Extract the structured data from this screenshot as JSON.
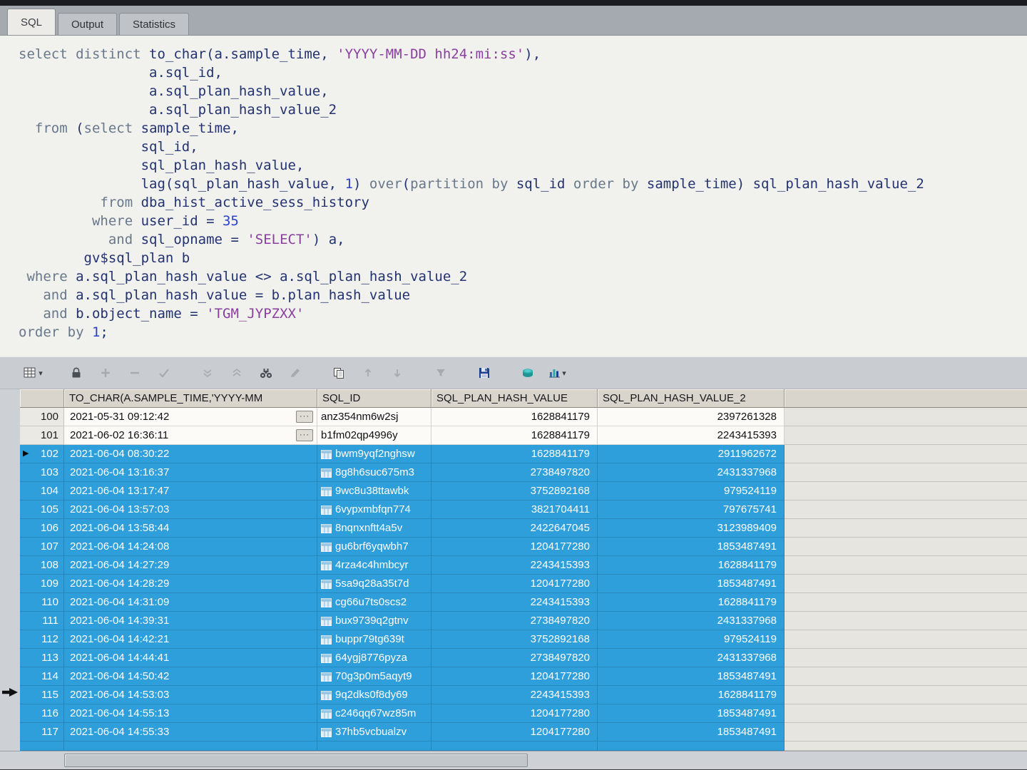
{
  "colors": {
    "selection": "#2E9FDB",
    "keyword": "#68788A",
    "identifier": "#233271",
    "string": "#8A3F9E",
    "number": "#2B3FD0"
  },
  "tabs": [
    {
      "label": "SQL",
      "active": true
    },
    {
      "label": "Output",
      "active": false
    },
    {
      "label": "Statistics",
      "active": false
    }
  ],
  "editor": {
    "lines": [
      [
        [
          "k",
          "select distinct "
        ],
        [
          "i",
          "to_char(a.sample_time, "
        ],
        [
          "s",
          "'YYYY-MM-DD hh24:mi:ss'"
        ],
        [
          "i",
          "),"
        ]
      ],
      [
        [
          "i",
          "                a.sql_id,"
        ]
      ],
      [
        [
          "i",
          "                a.sql_plan_hash_value,"
        ]
      ],
      [
        [
          "i",
          "                a.sql_plan_hash_value_2"
        ]
      ],
      [
        [
          "i",
          "  "
        ],
        [
          "k",
          "from "
        ],
        [
          "i",
          "("
        ],
        [
          "k",
          "select "
        ],
        [
          "i",
          "sample_time,"
        ]
      ],
      [
        [
          "i",
          "               sql_id,"
        ]
      ],
      [
        [
          "i",
          "               sql_plan_hash_value,"
        ]
      ],
      [
        [
          "i",
          "               lag(sql_plan_hash_value, "
        ],
        [
          "n",
          "1"
        ],
        [
          "i",
          ") "
        ],
        [
          "k",
          "over"
        ],
        [
          "i",
          "("
        ],
        [
          "k",
          "partition by "
        ],
        [
          "i",
          "sql_id "
        ],
        [
          "k",
          "order by "
        ],
        [
          "i",
          "sample_time) sql_plan_hash_value_2"
        ]
      ],
      [
        [
          "i",
          "          "
        ],
        [
          "k",
          "from "
        ],
        [
          "i",
          "dba_hist_active_sess_history"
        ]
      ],
      [
        [
          "i",
          "         "
        ],
        [
          "k",
          "where "
        ],
        [
          "i",
          "user_id = "
        ],
        [
          "n",
          "35"
        ]
      ],
      [
        [
          "i",
          "           "
        ],
        [
          "k",
          "and "
        ],
        [
          "i",
          "sql_opname = "
        ],
        [
          "s",
          "'SELECT'"
        ],
        [
          "i",
          ") a,"
        ]
      ],
      [
        [
          "i",
          "        gv$sql_plan b"
        ]
      ],
      [
        [
          "i",
          " "
        ],
        [
          "k",
          "where "
        ],
        [
          "i",
          "a.sql_plan_hash_value <> a.sql_plan_hash_value_2"
        ]
      ],
      [
        [
          "i",
          "   "
        ],
        [
          "k",
          "and "
        ],
        [
          "i",
          "a.sql_plan_hash_value = b.plan_hash_value"
        ]
      ],
      [
        [
          "i",
          "   "
        ],
        [
          "k",
          "and "
        ],
        [
          "i",
          "b.object_name = "
        ],
        [
          "s",
          "'TGM_JYPZXX'"
        ]
      ],
      [
        [
          "k",
          "order by "
        ],
        [
          "n",
          "1"
        ],
        [
          "i",
          ";"
        ]
      ]
    ]
  },
  "toolbar": {
    "icons": [
      {
        "name": "grid-options-icon",
        "dropdown": true
      },
      {
        "name": "lock-icon",
        "gapBefore": true
      },
      {
        "name": "insert-row-icon",
        "disabled": true
      },
      {
        "name": "delete-row-icon",
        "disabled": true
      },
      {
        "name": "post-changes-icon",
        "disabled": true
      },
      {
        "name": "revert-icon",
        "disabled": true,
        "gapBefore": true
      },
      {
        "name": "refresh-icon",
        "disabled": true
      },
      {
        "name": "find-icon"
      },
      {
        "name": "edit-icon",
        "disabled": true
      },
      {
        "name": "copy-icon",
        "gapBefore": true
      },
      {
        "name": "sort-asc-icon",
        "disabled": true
      },
      {
        "name": "sort-desc-icon",
        "disabled": true
      },
      {
        "name": "filter-icon",
        "disabled": true,
        "gapBefore": true
      },
      {
        "name": "save-icon",
        "gapBefore": true
      },
      {
        "name": "export-icon",
        "gapBefore": true
      },
      {
        "name": "chart-icon",
        "dropdown": true
      }
    ]
  },
  "grid": {
    "columns": [
      {
        "label": "TO_CHAR(A.SAMPLE_TIME,'YYYY-MM"
      },
      {
        "label": "SQL_ID"
      },
      {
        "label": "SQL_PLAN_HASH_VALUE"
      },
      {
        "label": "SQL_PLAN_HASH_VALUE_2"
      }
    ],
    "rows": [
      {
        "num": "100",
        "time": "2021-05-31 09:12:42",
        "sql_id": "anz354nm6w2sj",
        "hash1": "1628841179",
        "hash2": "2397261328",
        "selected": false
      },
      {
        "num": "101",
        "time": "2021-06-02 16:36:11",
        "sql_id": "b1fm02qp4996y",
        "hash1": "1628841179",
        "hash2": "2243415393",
        "selected": false
      },
      {
        "num": "102",
        "time": "2021-06-04 08:30:22",
        "sql_id": "bwm9yqf2nghsw",
        "hash1": "1628841179",
        "hash2": "2911962672",
        "selected": true,
        "marker": true
      },
      {
        "num": "103",
        "time": "2021-06-04 13:16:37",
        "sql_id": "8g8h6suc675m3",
        "hash1": "2738497820",
        "hash2": "2431337968",
        "selected": true
      },
      {
        "num": "104",
        "time": "2021-06-04 13:17:47",
        "sql_id": "9wc8u38ttawbk",
        "hash1": "3752892168",
        "hash2": "979524119",
        "selected": true
      },
      {
        "num": "105",
        "time": "2021-06-04 13:57:03",
        "sql_id": "6vypxmbfqn774",
        "hash1": "3821704411",
        "hash2": "797675741",
        "selected": true
      },
      {
        "num": "106",
        "time": "2021-06-04 13:58:44",
        "sql_id": "8nqnxnftt4a5v",
        "hash1": "2422647045",
        "hash2": "3123989409",
        "selected": true
      },
      {
        "num": "107",
        "time": "2021-06-04 14:24:08",
        "sql_id": "gu6brf6yqwbh7",
        "hash1": "1204177280",
        "hash2": "1853487491",
        "selected": true
      },
      {
        "num": "108",
        "time": "2021-06-04 14:27:29",
        "sql_id": "4rza4c4hmbcyr",
        "hash1": "2243415393",
        "hash2": "1628841179",
        "selected": true
      },
      {
        "num": "109",
        "time": "2021-06-04 14:28:29",
        "sql_id": "5sa9q28a35t7d",
        "hash1": "1204177280",
        "hash2": "1853487491",
        "selected": true
      },
      {
        "num": "110",
        "time": "2021-06-04 14:31:09",
        "sql_id": "cg66u7ts0scs2",
        "hash1": "2243415393",
        "hash2": "1628841179",
        "selected": true
      },
      {
        "num": "111",
        "time": "2021-06-04 14:39:31",
        "sql_id": "bux9739q2gtnv",
        "hash1": "2738497820",
        "hash2": "2431337968",
        "selected": true
      },
      {
        "num": "112",
        "time": "2021-06-04 14:42:21",
        "sql_id": "buppr79tg639t",
        "hash1": "3752892168",
        "hash2": "979524119",
        "selected": true
      },
      {
        "num": "113",
        "time": "2021-06-04 14:44:41",
        "sql_id": "64ygj8776pyza",
        "hash1": "2738497820",
        "hash2": "2431337968",
        "selected": true
      },
      {
        "num": "114",
        "time": "2021-06-04 14:50:42",
        "sql_id": "70g3p0m5aqyt9",
        "hash1": "1204177280",
        "hash2": "1853487491",
        "selected": true
      },
      {
        "num": "115",
        "time": "2021-06-04 14:53:03",
        "sql_id": "9q2dks0f8dy69",
        "hash1": "2243415393",
        "hash2": "1628841179",
        "selected": true
      },
      {
        "num": "116",
        "time": "2021-06-04 14:55:13",
        "sql_id": "c246qq67wz85m",
        "hash1": "1204177280",
        "hash2": "1853487491",
        "selected": true
      },
      {
        "num": "117",
        "time": "2021-06-04 14:55:33",
        "sql_id": "37hb5vcbualzv",
        "hash1": "1204177280",
        "hash2": "1853487491",
        "selected": true
      }
    ]
  }
}
